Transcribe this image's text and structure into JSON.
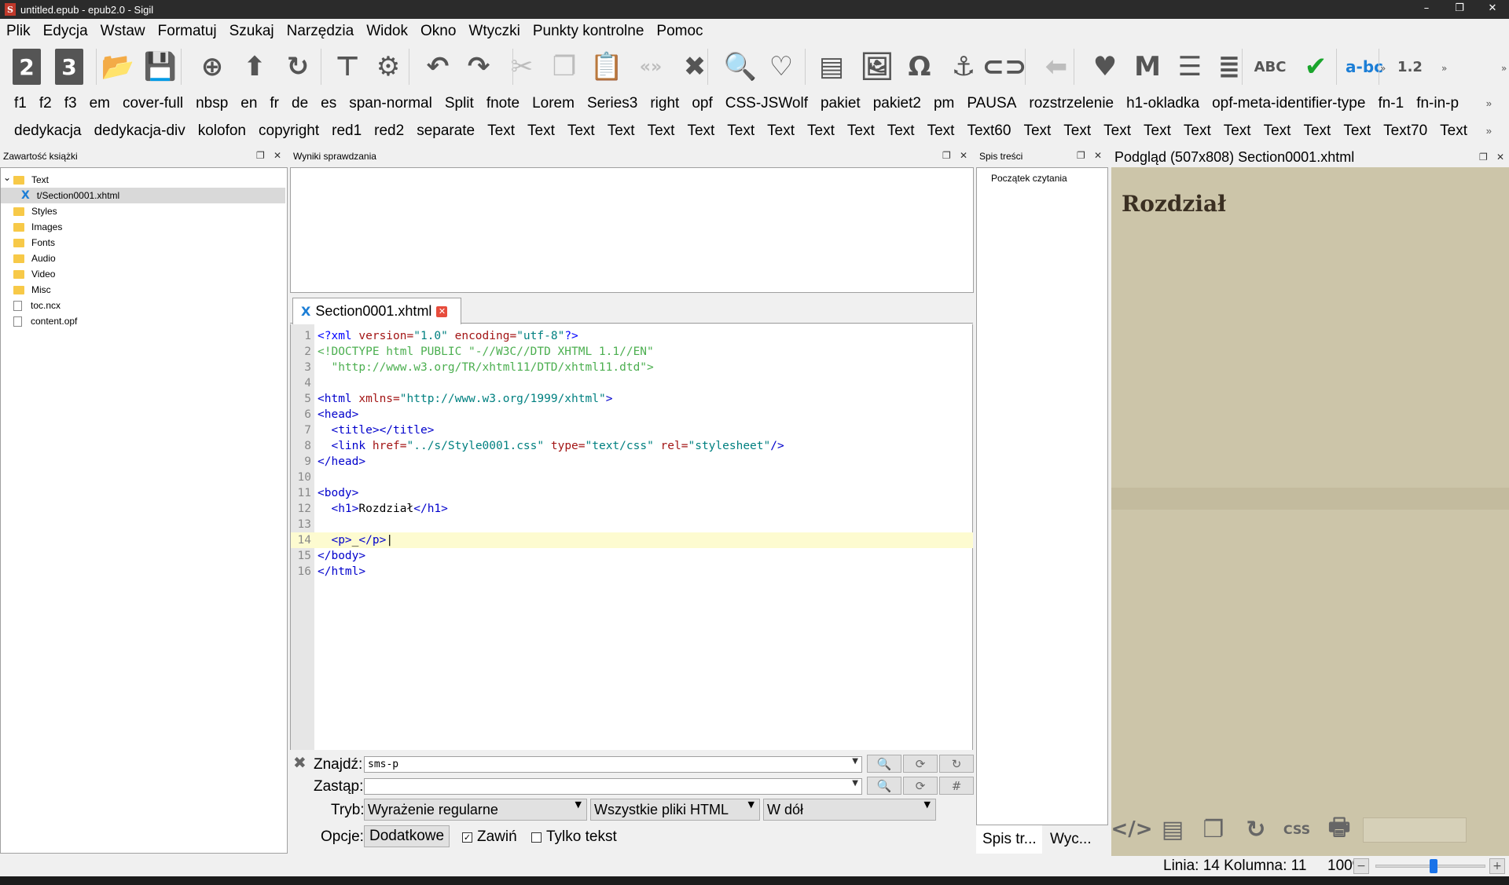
{
  "window": {
    "title": "untitled.epub - epub2.0 - Sigil",
    "minimize": "–",
    "restore": "❐",
    "close": "✕"
  },
  "menu": [
    "Plik",
    "Edycja",
    "Wstaw",
    "Formatuj",
    "Szukaj",
    "Narzędzia",
    "Widok",
    "Okno",
    "Wtyczki",
    "Punkty kontrolne",
    "Pomoc"
  ],
  "toolbar": {
    "heading2": "2",
    "heading3": "3",
    "icons": [
      "open-folder-icon",
      "save-icon",
      "add-icon",
      "move-up-icon",
      "redo-icon",
      "split-icon",
      "settings-icon",
      "undo-icon",
      "redo-arrow-icon",
      "cut-icon",
      "copy-icon",
      "paste-icon",
      "code-tags-icon",
      "close-x-icon",
      "search-icon",
      "search-heart-icon",
      "printer-icon",
      "image-icon",
      "omega-icon",
      "anchor-icon",
      "link-icon",
      "arrow-left-icon",
      "heart-icon",
      "m-icon",
      "list-icon",
      "list-numbered-icon",
      "spellcheck-icon",
      "validate-icon",
      "hyphenate-icon",
      "numbered-list-icon"
    ],
    "glyphs": [
      "📂",
      "💾",
      "⊕",
      "⬆",
      "↻",
      "⊤",
      "⚙",
      "↶",
      "↷",
      "✂",
      "❐",
      "📋",
      "«»",
      "✖",
      "🔍",
      "♡",
      "▤",
      "🖼",
      "Ω",
      "⚓",
      "⊂⊃",
      "⬅",
      "♥",
      "M",
      "☰",
      "≣",
      "ABC",
      "✔",
      "a-bc",
      "1.2"
    ]
  },
  "cliprow1": [
    "f1",
    "f2",
    "f3",
    "em",
    "cover-full",
    "nbsp",
    "en",
    "fr",
    "de",
    "es",
    "span-normal",
    "Split",
    "fnote",
    "Lorem",
    "Series3",
    "right",
    "opf",
    "CSS-JSWolf",
    "pakiet",
    "pakiet2",
    "pm",
    "PAUSA",
    "rozstrzelenie",
    "h1-okladka",
    "opf-meta-identifier-type",
    "fn-1",
    "fn-in-p"
  ],
  "cliprow2": [
    "dedykacja",
    "dedykacja-div",
    "kolofon",
    "copyright",
    "red1",
    "red2",
    "separate",
    "Text",
    "Text",
    "Text",
    "Text",
    "Text",
    "Text",
    "Text",
    "Text",
    "Text",
    "Text",
    "Text",
    "Text",
    "Text60",
    "Text",
    "Text",
    "Text",
    "Text",
    "Text",
    "Text",
    "Text",
    "Text",
    "Text",
    "Text70",
    "Text"
  ],
  "book_browser": {
    "title": "Zawartość książki",
    "items": [
      {
        "label": "Text",
        "type": "folder",
        "expanded": true
      },
      {
        "label": "t/Section0001.xhtml",
        "type": "xhtml",
        "selected": true
      },
      {
        "label": "Styles",
        "type": "folder"
      },
      {
        "label": "Images",
        "type": "folder"
      },
      {
        "label": "Fonts",
        "type": "folder"
      },
      {
        "label": "Audio",
        "type": "folder"
      },
      {
        "label": "Video",
        "type": "folder"
      },
      {
        "label": "Misc",
        "type": "folder"
      },
      {
        "label": "toc.ncx",
        "type": "file"
      },
      {
        "label": "content.opf",
        "type": "file"
      }
    ]
  },
  "validation": {
    "title": "Wyniki sprawdzania"
  },
  "editor": {
    "tab": "Section0001.xhtml",
    "current_line": 14,
    "lines": [
      [
        [
          "pi",
          "<?xml "
        ],
        [
          "attr",
          "version="
        ],
        [
          "str",
          "\"1.0\""
        ],
        [
          "attr",
          " encoding="
        ],
        [
          "str",
          "\"utf-8\""
        ],
        [
          "pi",
          "?>"
        ]
      ],
      [
        [
          "dt",
          "<!DOCTYPE html PUBLIC \"-//W3C//DTD XHTML 1.1//EN\""
        ]
      ],
      [
        [
          "dt",
          "  \"http://www.w3.org/TR/xhtml11/DTD/xhtml11.dtd\">"
        ]
      ],
      [],
      [
        [
          "tag",
          "<html "
        ],
        [
          "attr",
          "xmlns="
        ],
        [
          "str",
          "\"http://www.w3.org/1999/xhtml\""
        ],
        [
          "tag",
          ">"
        ]
      ],
      [
        [
          "tag",
          "<head>"
        ]
      ],
      [
        [
          "text",
          "  "
        ],
        [
          "tag",
          "<title></title>"
        ]
      ],
      [
        [
          "text",
          "  "
        ],
        [
          "tag",
          "<link "
        ],
        [
          "attr",
          "href="
        ],
        [
          "str",
          "\"../s/Style0001.css\""
        ],
        [
          "attr",
          " type="
        ],
        [
          "str",
          "\"text/css\""
        ],
        [
          "attr",
          " rel="
        ],
        [
          "str",
          "\"stylesheet\""
        ],
        [
          "tag",
          "/>"
        ]
      ],
      [
        [
          "tag",
          "</head>"
        ]
      ],
      [],
      [
        [
          "tag",
          "<body>"
        ]
      ],
      [
        [
          "text",
          "  "
        ],
        [
          "tag",
          "<h1>"
        ],
        [
          "text",
          "Rozdział"
        ],
        [
          "tag",
          "</h1>"
        ]
      ],
      [],
      [
        [
          "text",
          "  "
        ],
        [
          "tag",
          "<p>"
        ],
        [
          "text",
          "_"
        ],
        [
          "tag",
          "</p>"
        ]
      ],
      [
        [
          "tag",
          "</body>"
        ]
      ],
      [
        [
          "tag",
          "</html>"
        ]
      ]
    ]
  },
  "find": {
    "find_label": "Znajdź:",
    "find_value": "sms-p",
    "replace_label": "Zastąp:",
    "replace_value": "",
    "mode_label": "Tryb:",
    "mode": "Wyrażenie regularne",
    "scope": "Wszystkie pliki HTML",
    "direction": "W dół",
    "options_label": "Opcje:",
    "extra_button": "Dodatkowe",
    "wrap_label": "Zawiń",
    "wrap_checked": true,
    "text_only_label": "Tylko tekst",
    "text_only_checked": false,
    "close": "✖",
    "hash": "#"
  },
  "toc": {
    "title": "Spis treści",
    "entry": "Początek czytania",
    "tab1": "Spis tr...",
    "tab2": "Wyc..."
  },
  "preview": {
    "title": "Podgląd (507x808) Section0001.xhtml",
    "heading": "Rozdział"
  },
  "preview_tools": [
    "</>",
    "▤",
    "❐",
    "↻",
    "CSS",
    "🖶"
  ],
  "status": {
    "position": "Linia: 14 Kolumna: 11",
    "zoom": "100%",
    "zoom_level": 0.52,
    "minus": "−",
    "plus": "+"
  }
}
